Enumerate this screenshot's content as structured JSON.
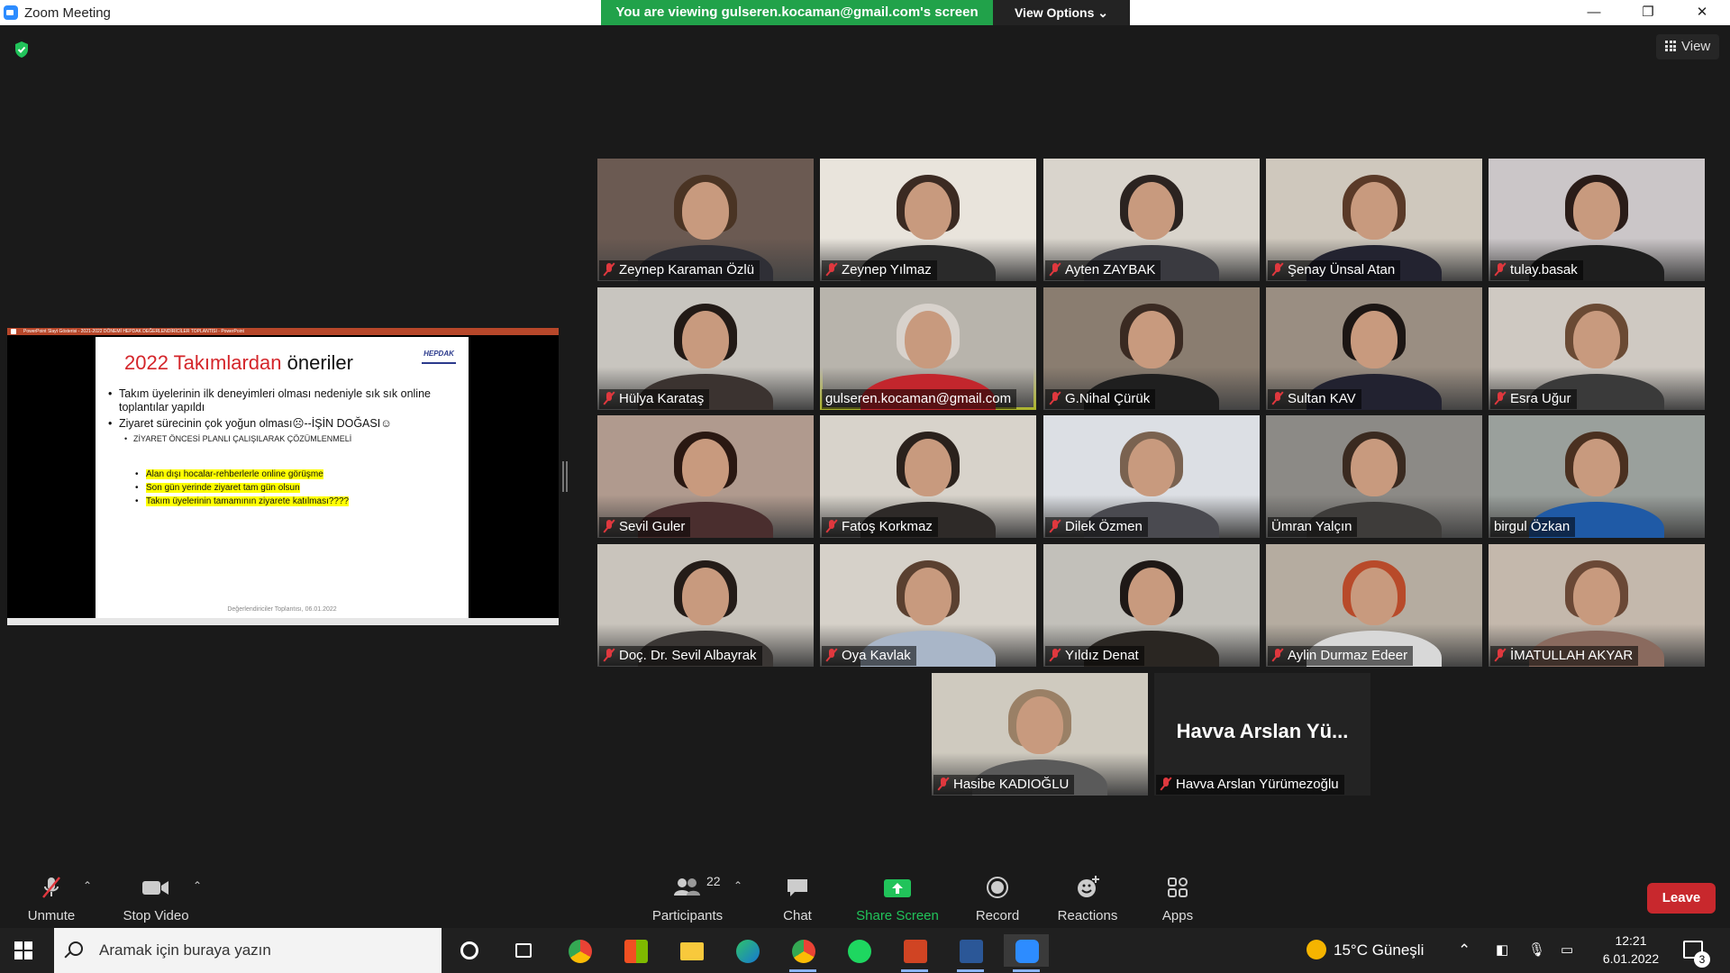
{
  "window": {
    "title": "Zoom Meeting",
    "viewing_banner": "You are viewing gulseren.kocaman@gmail.com's screen",
    "view_options": "View Options",
    "view_button": "View"
  },
  "shared_screen": {
    "ppt_titlebar": "PowerPoint Slayt Gösterisi - 2021-2022 DÖNEMİ HEPDAK DEĞERLENDİRİCİLER TOPLANTISI - PowerPoint",
    "slide": {
      "title_red": "2022 Takımlardan",
      "title_black": "öneriler",
      "logo": "HEPDAK",
      "bullets": [
        "Takım üyelerinin ilk deneyimleri olması nedeniyle sık sık online toplantılar yapıldı",
        "Ziyaret sürecinin çok yoğun olması☹--İŞİN DOĞASI☺"
      ],
      "sub_bullet": "ZİYARET ÖNCESİ PLANLI ÇALIŞILARAK ÇÖZÜMLENMELİ",
      "highlighted": [
        "Alan dışı hocalar-rehberlerle online görüşme",
        "Son gün yerinde ziyaret tam gün olsun",
        "Takım üyelerinin tamamının ziyarete katılması????"
      ],
      "footer": "Değerlendiriciler Toplantısı, 06.01.2022"
    }
  },
  "participants": [
    {
      "name": "Zeynep Karaman Özlü",
      "muted": true,
      "bg": "#6b5a52",
      "hair": "#4a3424",
      "body": "#2f2f36"
    },
    {
      "name": "Zeynep Yılmaz",
      "muted": true,
      "bg": "#e9e4dc",
      "hair": "#3b2a22",
      "body": "#2a2a2a"
    },
    {
      "name": "Ayten ZAYBAK",
      "muted": true,
      "bg": "#d9d4cc",
      "hair": "#2b2320",
      "body": "#3a3a40"
    },
    {
      "name": "Şenay Ünsal Atan",
      "muted": true,
      "bg": "#cfc8bd",
      "hair": "#5a3a28",
      "body": "#232330"
    },
    {
      "name": "tulay.basak",
      "muted": true,
      "bg": "#cbc6c8",
      "hair": "#2a1c18",
      "body": "#1e1e1e"
    },
    {
      "name": "Hülya Karataş",
      "muted": true,
      "bg": "#c8c5bf",
      "hair": "#221a16",
      "body": "#3b3330"
    },
    {
      "name": "gulseren.kocaman@gmail.com",
      "muted": false,
      "bg": "#b8b4ac",
      "hair": "#d8d2cc",
      "body": "#c3262d",
      "active": true
    },
    {
      "name": "G.Nihal Çürük",
      "muted": true,
      "bg": "#8a7d70",
      "hair": "#3a2a22",
      "body": "#1f1f1f"
    },
    {
      "name": "Sultan KAV",
      "muted": true,
      "bg": "#9a8e82",
      "hair": "#1c1614",
      "body": "#222230"
    },
    {
      "name": "Esra Uğur",
      "muted": true,
      "bg": "#cfc9c2",
      "hair": "#6a4a34",
      "body": "#3a3a3a"
    },
    {
      "name": "Sevil Guler",
      "muted": true,
      "bg": "#b09a8e",
      "hair": "#2a1812",
      "body": "#4a2e2e"
    },
    {
      "name": "Fatoş Korkmaz",
      "muted": true,
      "bg": "#d8d3cb",
      "hair": "#2a211c",
      "body": "#2e2a28"
    },
    {
      "name": "Dilek Özmen",
      "muted": true,
      "bg": "#dcdfe4",
      "hair": "#7a6250",
      "body": "#4a4a50"
    },
    {
      "name": "Ümran Yalçın",
      "muted": false,
      "bg": "#8c8a86",
      "hair": "#3a2a20",
      "body": "#3e3c3a"
    },
    {
      "name": "birgul Özkan",
      "muted": false,
      "bg": "#9aa09c",
      "hair": "#4a3020",
      "body": "#1f5aa6"
    },
    {
      "name": "Doç. Dr. Sevil Albayrak",
      "muted": true,
      "bg": "#c9c4bc",
      "hair": "#241c18",
      "body": "#3a3634"
    },
    {
      "name": "Oya Kavlak",
      "muted": true,
      "bg": "#d6d1c9",
      "hair": "#5a4030",
      "body": "#a9b6c8"
    },
    {
      "name": "Yıldız Denat",
      "muted": true,
      "bg": "#c2c0ba",
      "hair": "#1e1816",
      "body": "#2a2622"
    },
    {
      "name": "Aylin Durmaz Edeer",
      "muted": true,
      "bg": "#b5aca0",
      "hair": "#b84a2a",
      "body": "#d8d8d8"
    },
    {
      "name": "İMATULLAH AKYAR",
      "muted": true,
      "bg": "#c4b8ac",
      "hair": "#6a4836",
      "body": "#8a6a5e"
    },
    {
      "name": "Hasibe KADIOĞLU",
      "muted": true,
      "bg": "#cfcabf",
      "hair": "#9a8066",
      "body": "#5a5a5a"
    },
    {
      "name": "Havva Arslan Yürümezoğlu",
      "muted": true,
      "no_video": true,
      "display": "Havva Arslan Yü..."
    }
  ],
  "toolbar": {
    "unmute": "Unmute",
    "stop_video": "Stop Video",
    "participants": "Participants",
    "participants_count": "22",
    "chat": "Chat",
    "share_screen": "Share Screen",
    "record": "Record",
    "reactions": "Reactions",
    "apps": "Apps",
    "leave": "Leave"
  },
  "taskbar": {
    "search_placeholder": "Aramak için buraya yazın",
    "weather": "15°C Güneşli",
    "time": "12:21",
    "date": "6.01.2022",
    "notifications": "3"
  },
  "colors": {
    "zoom_blue": "#2d8cff",
    "banner_green": "#21a24a",
    "share_green": "#21c35a",
    "leave_red": "#c8282d",
    "active_speaker": "#e6f03a"
  }
}
